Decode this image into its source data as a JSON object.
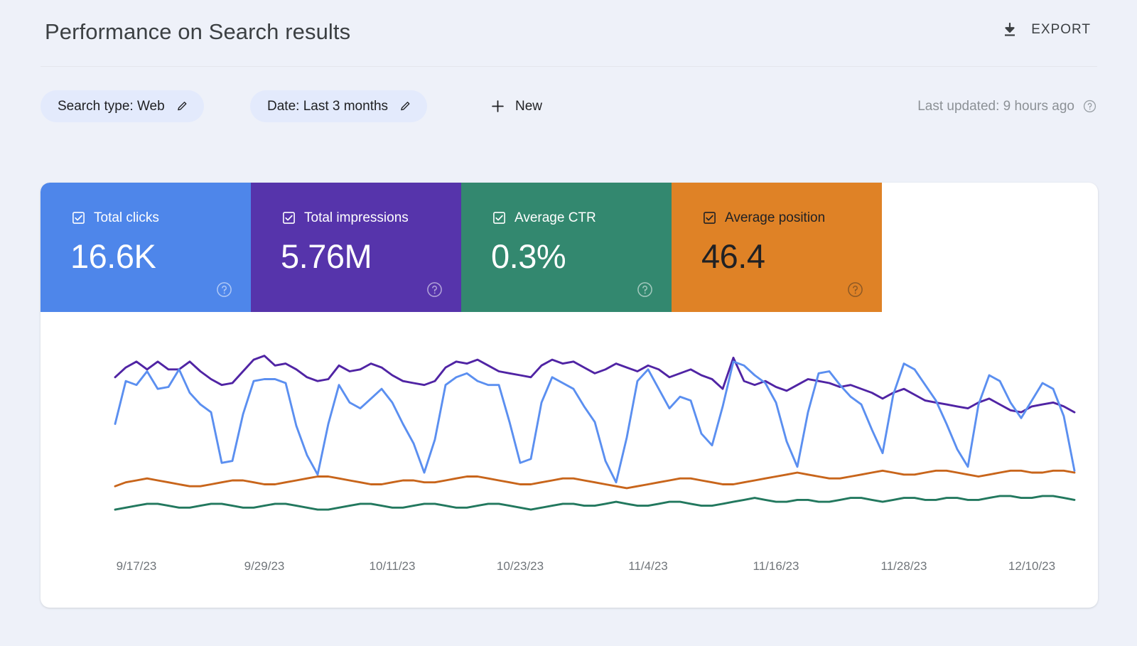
{
  "header": {
    "title": "Performance on Search results",
    "export_label": "EXPORT",
    "export_icon": "download-icon"
  },
  "filters": {
    "chips": [
      {
        "label": "Search type: Web",
        "icon": "pencil-icon"
      },
      {
        "label": "Date: Last 3 months",
        "icon": "pencil-icon"
      }
    ],
    "new_label": "New",
    "new_icon": "plus-icon",
    "last_updated": "Last updated: 9 hours ago",
    "help_icon": "help-circle-icon"
  },
  "metrics": [
    {
      "name": "Total clicks",
      "value": "16.6K",
      "color": "#4e86ea",
      "text": "light",
      "checked": true,
      "icon": "checkbox-checked-icon",
      "help_icon": "help-circle-icon"
    },
    {
      "name": "Total impressions",
      "value": "5.76M",
      "color": "#5634ab",
      "text": "light",
      "checked": true,
      "icon": "checkbox-checked-icon",
      "help_icon": "help-circle-icon"
    },
    {
      "name": "Average CTR",
      "value": "0.3%",
      "color": "#33886f",
      "text": "light",
      "checked": true,
      "icon": "checkbox-checked-icon",
      "help_icon": "help-circle-icon"
    },
    {
      "name": "Average position",
      "value": "46.4",
      "color": "#df8226",
      "text": "dark",
      "checked": true,
      "icon": "checkbox-checked-icon",
      "help_icon": "help-circle-icon"
    }
  ],
  "chart_data": {
    "type": "line",
    "title": "Performance on Search results",
    "xlabel": "",
    "ylabel": "",
    "grid": false,
    "legend": "metric-tiles-above",
    "x_tick_labels": [
      "9/17/23",
      "9/29/23",
      "10/11/23",
      "10/23/23",
      "11/4/23",
      "11/16/23",
      "11/28/23",
      "12/10/23"
    ],
    "x_tick_indices": [
      2,
      14,
      26,
      38,
      50,
      62,
      74,
      86
    ],
    "x_range": [
      "9/15/23",
      "12/14/23"
    ],
    "n_points": 91,
    "series": [
      {
        "name": "Total clicks",
        "color": "#5b8ff0",
        "values": [
          52,
          74,
          72,
          79,
          70,
          71,
          80,
          68,
          62,
          58,
          32,
          33,
          57,
          74,
          75,
          75,
          73,
          51,
          36,
          26,
          52,
          72,
          63,
          60,
          65,
          70,
          63,
          52,
          42,
          27,
          44,
          72,
          76,
          78,
          74,
          72,
          72,
          53,
          32,
          34,
          63,
          76,
          73,
          70,
          61,
          53,
          33,
          22,
          45,
          74,
          80,
          70,
          60,
          66,
          64,
          47,
          41,
          61,
          84,
          82,
          77,
          73,
          63,
          43,
          30,
          58,
          78,
          79,
          72,
          66,
          62,
          49,
          37,
          67,
          83,
          80,
          72,
          64,
          52,
          39,
          30,
          62,
          77,
          74,
          63,
          55,
          64,
          73,
          70,
          56,
          28
        ]
      },
      {
        "name": "Total impressions",
        "color": "#5024a4",
        "values": [
          76,
          81,
          84,
          80,
          84,
          80,
          80,
          84,
          79,
          75,
          72,
          73,
          79,
          85,
          87,
          82,
          83,
          80,
          76,
          74,
          75,
          82,
          79,
          80,
          83,
          81,
          77,
          74,
          73,
          72,
          74,
          81,
          84,
          83,
          85,
          82,
          79,
          78,
          77,
          76,
          82,
          85,
          83,
          84,
          81,
          78,
          80,
          83,
          81,
          79,
          82,
          80,
          76,
          78,
          80,
          77,
          75,
          70,
          86,
          74,
          72,
          74,
          71,
          69,
          72,
          75,
          74,
          73,
          71,
          72,
          70,
          68,
          65,
          68,
          70,
          67,
          64,
          63,
          62,
          61,
          60,
          63,
          65,
          62,
          59,
          58,
          61,
          62,
          63,
          61,
          58
        ]
      },
      {
        "name": "Average position",
        "color": "#c8651b",
        "values": [
          20,
          22,
          23,
          24,
          23,
          22,
          21,
          20,
          20,
          21,
          22,
          23,
          23,
          22,
          21,
          21,
          22,
          23,
          24,
          25,
          25,
          24,
          23,
          22,
          21,
          21,
          22,
          23,
          23,
          22,
          22,
          23,
          24,
          25,
          25,
          24,
          23,
          22,
          21,
          21,
          22,
          23,
          24,
          24,
          23,
          22,
          21,
          20,
          19,
          20,
          21,
          22,
          23,
          24,
          24,
          23,
          22,
          21,
          21,
          22,
          23,
          24,
          25,
          26,
          27,
          26,
          25,
          24,
          24,
          25,
          26,
          27,
          28,
          27,
          26,
          26,
          27,
          28,
          28,
          27,
          26,
          25,
          26,
          27,
          28,
          28,
          27,
          27,
          28,
          28,
          27
        ]
      },
      {
        "name": "Average CTR",
        "color": "#22785e",
        "values": [
          8,
          9,
          10,
          11,
          11,
          10,
          9,
          9,
          10,
          11,
          11,
          10,
          9,
          9,
          10,
          11,
          11,
          10,
          9,
          8,
          8,
          9,
          10,
          11,
          11,
          10,
          9,
          9,
          10,
          11,
          11,
          10,
          9,
          9,
          10,
          11,
          11,
          10,
          9,
          8,
          9,
          10,
          11,
          11,
          10,
          10,
          11,
          12,
          11,
          10,
          10,
          11,
          12,
          12,
          11,
          10,
          10,
          11,
          12,
          13,
          14,
          13,
          12,
          12,
          13,
          13,
          12,
          12,
          13,
          14,
          14,
          13,
          12,
          13,
          14,
          14,
          13,
          13,
          14,
          14,
          13,
          13,
          14,
          15,
          15,
          14,
          14,
          15,
          15,
          14,
          13
        ]
      }
    ]
  }
}
